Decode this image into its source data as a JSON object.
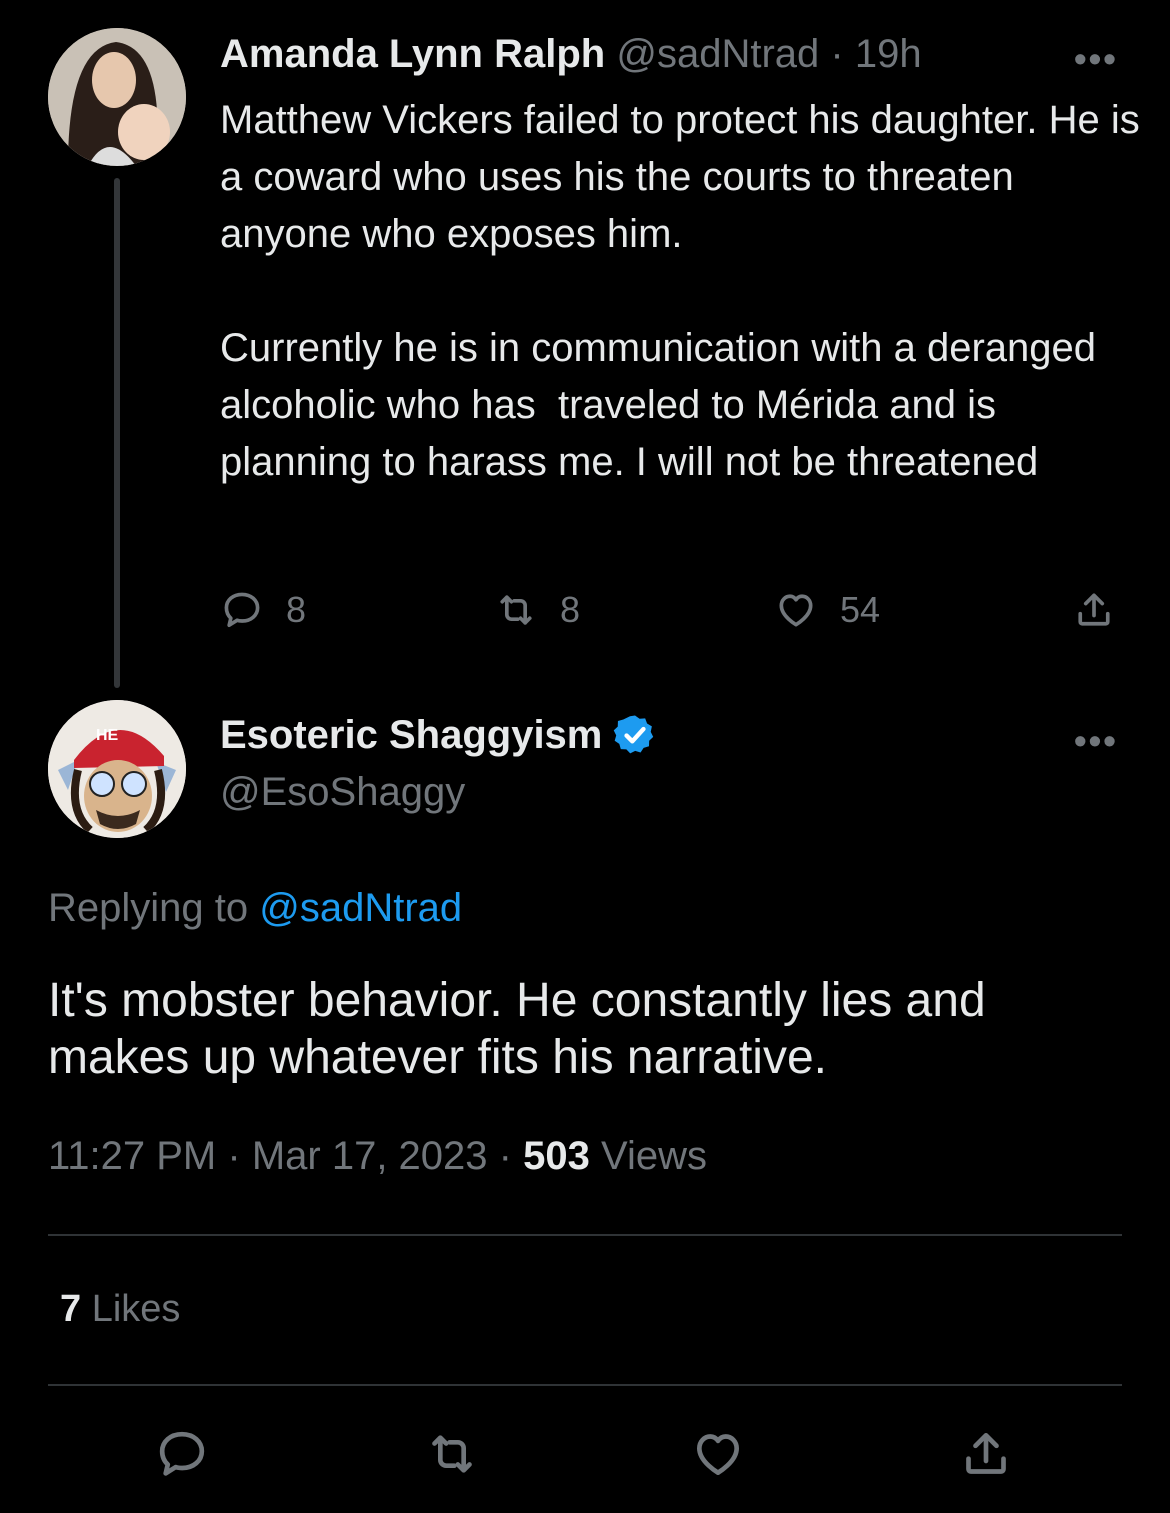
{
  "tweet1": {
    "name": "Amanda Lynn Ralph",
    "handle": "@sadNtrad",
    "separator": "·",
    "time": "19h",
    "more": "•••",
    "paragraph1": "Matthew Vickers failed to protect his daughter. He is a coward who uses his the courts to threaten anyone who exposes him.",
    "paragraph2": "Currently he is in communication with a deranged alcoholic who has  traveled to Mérida and is planning to harass me. I will not be threatened",
    "replies": "8",
    "retweets": "8",
    "likes": "54",
    "icons": [
      "reply-icon",
      "retweet-icon",
      "like-icon",
      "share-icon"
    ]
  },
  "tweet2": {
    "name": "Esoteric Shaggyism",
    "handle": "@EsoShaggy",
    "more": "•••",
    "replying_prefix": "Replying to ",
    "replying_to": "@sadNtrad",
    "body": "It's mobster behavior. He constantly lies and makes up whatever fits his narrative.",
    "time": "11:27 PM",
    "date": "Mar 17, 2023",
    "dot": "·",
    "views_count": "503",
    "views_label": "Views",
    "likes_count": "7",
    "likes_label": "Likes"
  },
  "colors": {
    "background": "#000000",
    "text": "#e7e9ea",
    "muted": "#71767b",
    "link": "#1d9bf0",
    "verified": "#1d9bf0"
  }
}
